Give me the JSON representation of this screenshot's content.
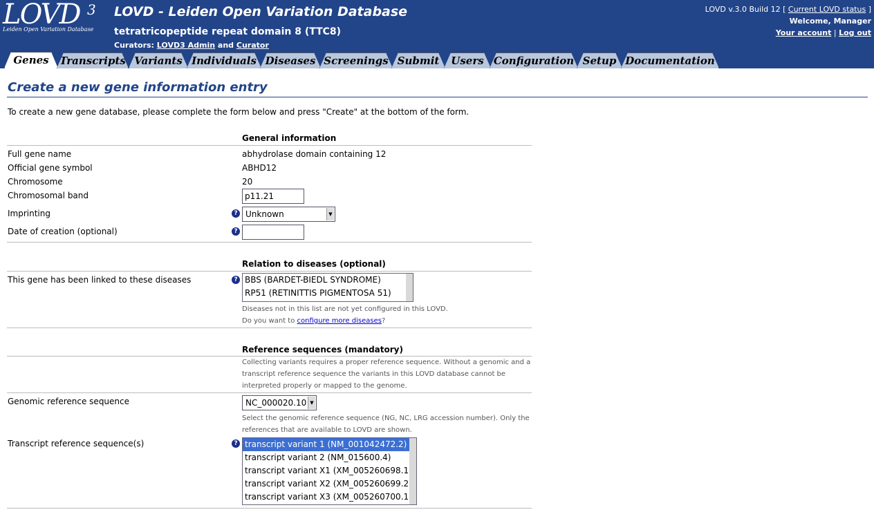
{
  "header": {
    "logo_text": "LOVD",
    "logo_sup": "3",
    "logo_tagline": "Leiden Open Variation Database",
    "app_title": "LOVD - Leiden Open Variation Database",
    "gene_title": "tetratricopeptide repeat domain 8 (TTC8)",
    "curators_prefix": "Curators:",
    "curator_1": "LOVD3 Admin",
    "curators_and": "and",
    "curator_2": "Curator",
    "version": "LOVD v.3.0 Build 12 [",
    "status_link": "Current LOVD status",
    "version_close": "]",
    "welcome": "Welcome, Manager",
    "account_link": "Your account",
    "separator": "|",
    "logout_link": "Log out"
  },
  "tabs": [
    {
      "label": "Genes"
    },
    {
      "label": "Transcripts"
    },
    {
      "label": "Variants"
    },
    {
      "label": "Individuals"
    },
    {
      "label": "Diseases"
    },
    {
      "label": "Screenings"
    },
    {
      "label": "Submit"
    },
    {
      "label": "Users"
    },
    {
      "label": "Configuration"
    },
    {
      "label": "Setup"
    },
    {
      "label": "Documentation"
    }
  ],
  "page": {
    "title": "Create a new gene information entry",
    "intro": "To create a new gene database, please complete the form below and press \"Create\" at the bottom of the form."
  },
  "general": {
    "heading": "General information",
    "full_name_label": "Full gene name",
    "full_name_value": "abhydrolase domain containing 12",
    "symbol_label": "Official gene symbol",
    "symbol_value": "ABHD12",
    "chromosome_label": "Chromosome",
    "chromosome_value": "20",
    "band_label": "Chromosomal band",
    "band_value": "p11.21",
    "imprinting_label": "Imprinting",
    "imprinting_value": "Unknown",
    "date_label": "Date of creation (optional)",
    "date_value": ""
  },
  "diseases": {
    "heading": "Relation to diseases (optional)",
    "label": "This gene has been linked to these diseases",
    "options": [
      "BBS (BARDET-BIEDL SYNDROME)",
      "RP51 (RETINITTIS PIGMENTOSA 51)"
    ],
    "note_1": "Diseases not in this list are not yet configured in this LOVD.",
    "note_2_pre": "Do you want to",
    "note_2_link": "configure more diseases",
    "note_2_post": "?"
  },
  "refseq": {
    "heading": "Reference sequences (mandatory)",
    "intro": "Collecting variants requires a proper reference sequence. Without a genomic and a transcript reference sequence the variants in this LOVD database cannot be interpreted properly or mapped to the genome.",
    "genomic_label": "Genomic reference sequence",
    "genomic_value": "NC_000020.10",
    "genomic_note": "Select the genomic reference sequence (NG, NC, LRG accession number). Only the references that are available to LOVD are shown.",
    "transcript_label": "Transcript reference sequence(s)",
    "transcripts": [
      "transcript variant 1 (NM_001042472.2)",
      "transcript variant 2 (NM_015600.4)",
      "transcript variant X1 (XM_005260698.1)",
      "transcript variant X2 (XM_005260699.2)",
      "transcript variant X3 (XM_005260700.1)"
    ]
  },
  "help_icon": "question-mark-icon",
  "colors": {
    "header_bg": "#224488",
    "title": "#224488",
    "selected_option": "#3c6fd1"
  }
}
